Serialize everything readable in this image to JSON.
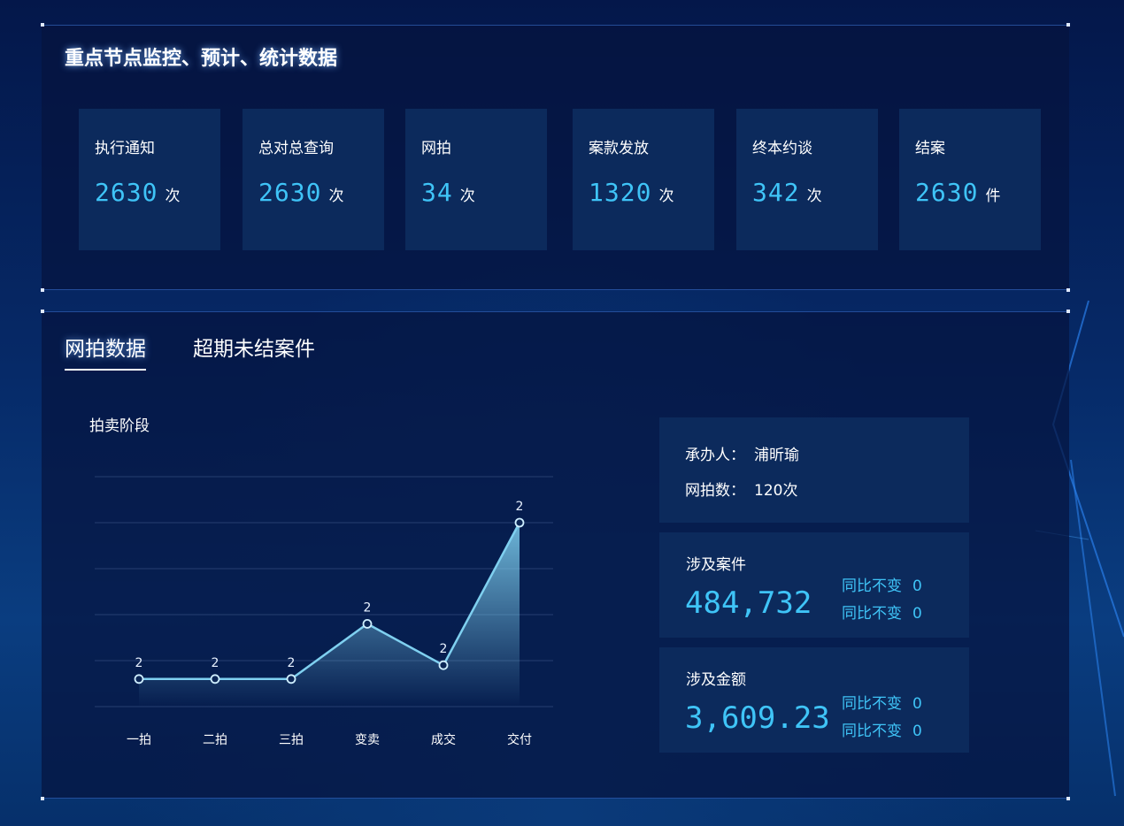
{
  "top_panel": {
    "title": "重点节点监控、预计、统计数据",
    "stats": [
      {
        "label": "执行通知",
        "value": "2630",
        "unit": "次"
      },
      {
        "label": "总对总查询",
        "value": "2630",
        "unit": "次"
      },
      {
        "label": "网拍",
        "value": "34",
        "unit": "次"
      },
      {
        "label": "案款发放",
        "value": "1320",
        "unit": "次"
      },
      {
        "label": "终本约谈",
        "value": "342",
        "unit": "次"
      },
      {
        "label": "结案",
        "value": "2630",
        "unit": "件"
      }
    ]
  },
  "bottom_panel": {
    "tabs": [
      {
        "label": "网拍数据",
        "active": true
      },
      {
        "label": "超期未结案件",
        "active": false
      }
    ],
    "chart_title": "拍卖阶段",
    "handler": {
      "label": "承办人：",
      "value": "浦昕瑜"
    },
    "auction_count": {
      "label": "网拍数：",
      "value": "120次"
    },
    "cases": {
      "label": "涉及案件",
      "value": "484,732",
      "yoy": [
        {
          "label": "同比不变",
          "value": "0"
        },
        {
          "label": "同比不变",
          "value": "0"
        }
      ]
    },
    "amount": {
      "label": "涉及金额",
      "value": "3,609.23",
      "yoy": [
        {
          "label": "同比不变",
          "value": "0"
        },
        {
          "label": "同比不变",
          "value": "0"
        }
      ]
    }
  },
  "colors": {
    "accent": "#3fc4f7",
    "card_bg": "#0c2a5c",
    "line": "#7fd0f0"
  },
  "chart_data": {
    "type": "area",
    "categories": [
      "一拍",
      "二拍",
      "三拍",
      "变卖",
      "成交",
      "交付"
    ],
    "values": [
      0.6,
      0.6,
      0.6,
      1.8,
      0.9,
      4.0
    ],
    "data_labels": [
      "2",
      "2",
      "2",
      "2",
      "2",
      "2"
    ],
    "ylim": [
      0,
      5
    ],
    "grid": true,
    "title": "拍卖阶段"
  }
}
